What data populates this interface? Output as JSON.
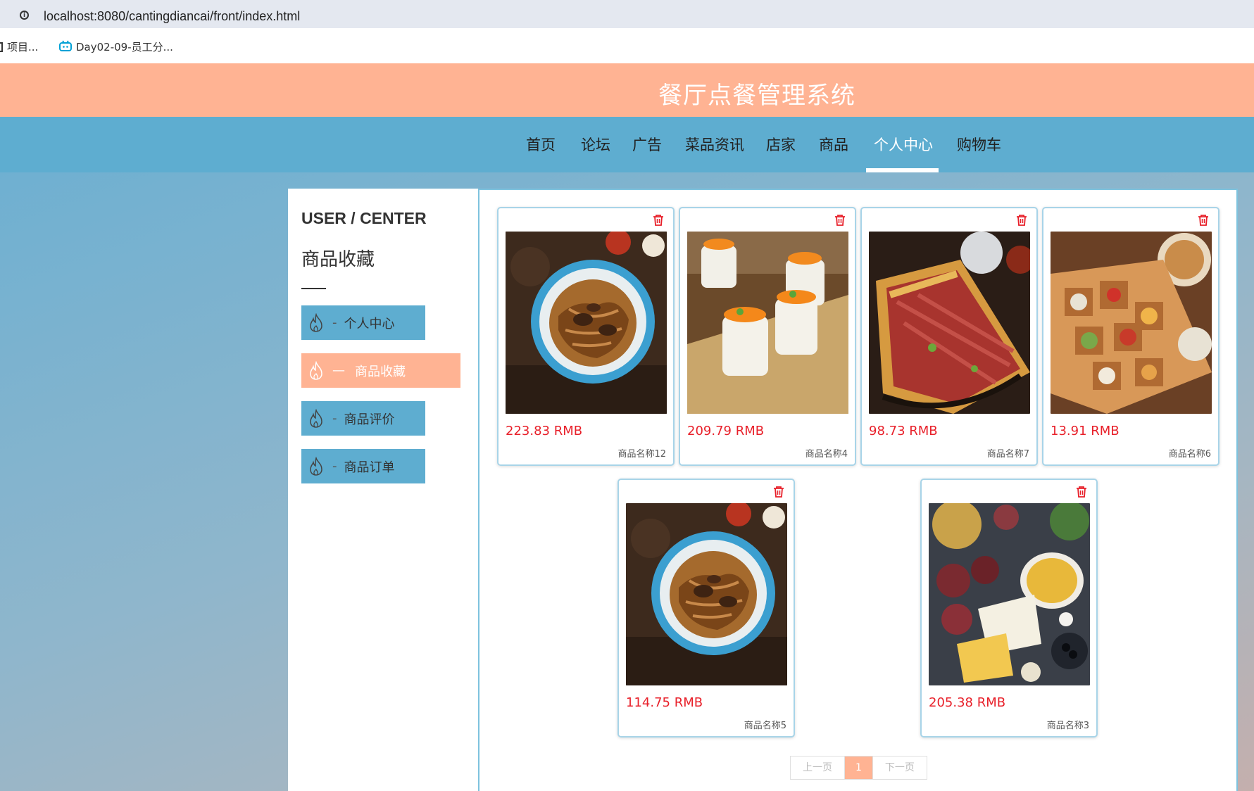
{
  "browser": {
    "url": "localhost:8080/cantingdiancai/front/index.html",
    "bookmarks": [
      "项目...",
      "Day02-09-员工分..."
    ]
  },
  "header": {
    "title": "餐厅点餐管理系统"
  },
  "nav": {
    "items": [
      "首页",
      "论坛",
      "广告",
      "菜品资讯",
      "店家",
      "商品",
      "个人中心",
      "购物车"
    ],
    "active": "个人中心"
  },
  "sidebar": {
    "title": "USER / CENTER",
    "subtitle": "商品收藏",
    "menu": [
      {
        "label": "个人中心",
        "dash": "-"
      },
      {
        "label": "商品收藏",
        "dash": "—"
      },
      {
        "label": "商品评价",
        "dash": "-"
      },
      {
        "label": "商品订单",
        "dash": "-"
      }
    ],
    "active": "商品收藏"
  },
  "products": [
    {
      "price": "223.83 RMB",
      "name": "商品名称12",
      "image": "noodles-bowl"
    },
    {
      "price": "209.79 RMB",
      "name": "商品名称4",
      "image": "sushi-rolls"
    },
    {
      "price": "98.73 RMB",
      "name": "商品名称7",
      "image": "beef-sandwich"
    },
    {
      "price": "13.91 RMB",
      "name": "商品名称6",
      "image": "bento-box"
    },
    {
      "price": "114.75 RMB",
      "name": "商品名称5",
      "image": "noodles-bowl"
    },
    {
      "price": "205.38 RMB",
      "name": "商品名称3",
      "image": "cheese-platter"
    }
  ],
  "pagination": {
    "prev": "上一页",
    "current": "1",
    "next": "下一页"
  },
  "colors": {
    "header": "#ffb393",
    "nav": "#5eadd0",
    "price": "#e8202a"
  }
}
